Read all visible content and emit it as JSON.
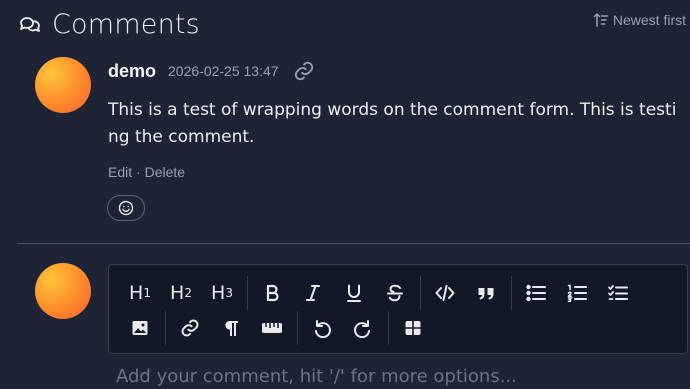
{
  "header": {
    "title": "Comments",
    "title_icon": "comments-icon",
    "sort_label": "Newest first",
    "sort_icon": "sort-icon"
  },
  "comment": {
    "author": "demo",
    "date": "2026-02-25 13:47",
    "permalink_icon": "link-icon",
    "text": "This is a test of wrapping words on the comment form. This is testing the comment.",
    "edit_label": "Edit",
    "separator": "·",
    "delete_label": "Delete",
    "reaction_icon": "smiley-icon"
  },
  "editor": {
    "toolbar_row1": [
      {
        "name": "heading-1",
        "label": "H",
        "sub": "1"
      },
      {
        "name": "heading-2",
        "label": "H",
        "sub": "2"
      },
      {
        "name": "heading-3",
        "label": "H",
        "sub": "3"
      },
      {
        "name": "bold-icon"
      },
      {
        "name": "italic-icon"
      },
      {
        "name": "underline-icon"
      },
      {
        "name": "strikethrough-icon"
      },
      {
        "name": "code-icon"
      },
      {
        "name": "quote-icon"
      },
      {
        "name": "bullet-list-icon"
      },
      {
        "name": "numbered-list-icon"
      },
      {
        "name": "task-list-icon"
      }
    ],
    "toolbar_row2": [
      {
        "name": "image-icon"
      },
      {
        "name": "link-icon"
      },
      {
        "name": "paragraph-icon"
      },
      {
        "name": "ruler-icon"
      },
      {
        "name": "undo-icon"
      },
      {
        "name": "redo-icon"
      },
      {
        "name": "table-icon"
      }
    ],
    "placeholder": "Add your comment, hit '/' for more options..."
  },
  "colors": {
    "background": "#1e2433",
    "editor_background": "#131826",
    "muted_text": "#9aa1b2",
    "avatar_gradient_start": "#ffc53a",
    "avatar_gradient_end": "#ff5a36"
  }
}
